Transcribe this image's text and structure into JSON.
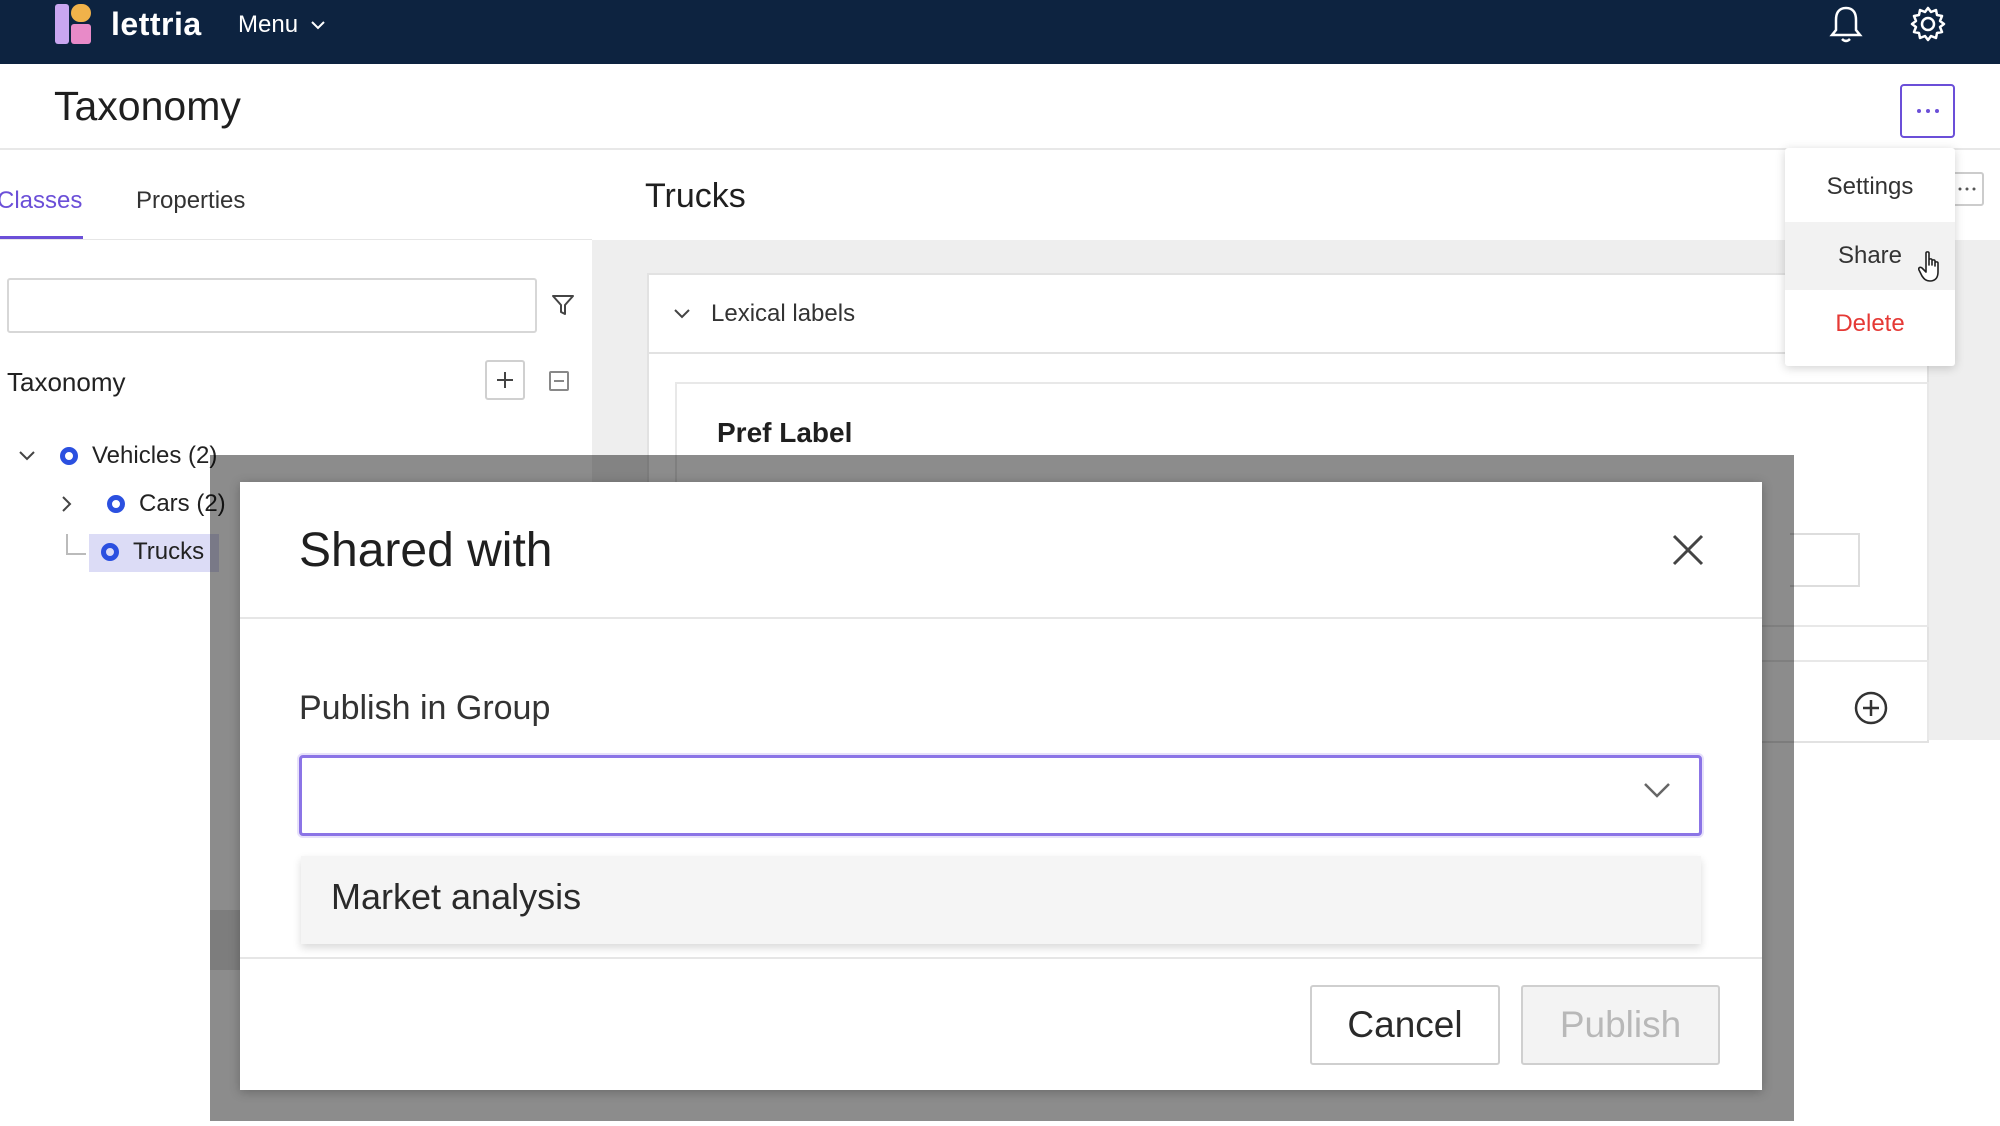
{
  "app": {
    "brand": "lettria",
    "menu_label": "Menu"
  },
  "header": {
    "title": "Taxonomy"
  },
  "tabs": [
    {
      "label": "Classes",
      "active": true
    },
    {
      "label": "Properties",
      "active": false
    }
  ],
  "left_panel": {
    "search_placeholder": "",
    "section_title": "Taxonomy",
    "tree": [
      {
        "label": "Vehicles (2)",
        "expanded": true
      },
      {
        "label": "Cars (2)",
        "expanded": false
      },
      {
        "label": "Trucks",
        "selected": true
      }
    ]
  },
  "content": {
    "title": "Trucks",
    "section": "Lexical labels",
    "field_title": "Pref Label"
  },
  "context_menu": {
    "items": [
      {
        "label": "Settings"
      },
      {
        "label": "Share",
        "hovered": true
      },
      {
        "label": "Delete"
      }
    ]
  },
  "modal": {
    "title": "Shared with",
    "field_label": "Publish in Group",
    "select_value": "",
    "options": [
      "Market analysis"
    ],
    "cancel_label": "Cancel",
    "publish_label": "Publish"
  },
  "colors": {
    "topbar": "#0d2340",
    "accent": "#6b4fd8",
    "node": "#2b50e0",
    "danger": "#e53935"
  }
}
